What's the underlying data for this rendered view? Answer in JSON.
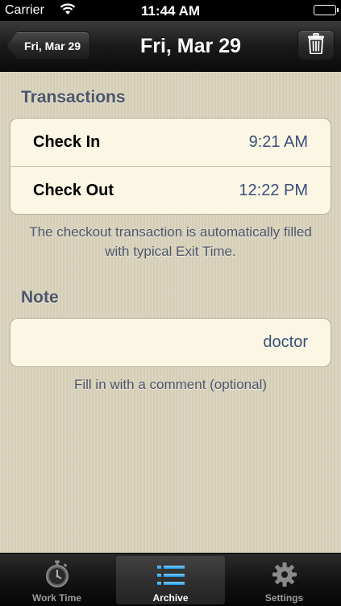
{
  "status_bar": {
    "carrier": "Carrier",
    "time": "11:44 AM"
  },
  "nav": {
    "back_label": "Fri, Mar 29",
    "title": "Fri, Mar 29"
  },
  "transactions": {
    "header": "Transactions",
    "rows": [
      {
        "label": "Check In",
        "value": "9:21 AM"
      },
      {
        "label": "Check Out",
        "value": "12:22 PM"
      }
    ],
    "footer": "The checkout transaction is automatically filled with typical Exit Time."
  },
  "note": {
    "header": "Note",
    "value": "doctor",
    "footer": "Fill in with a comment (optional)"
  },
  "tabs": [
    {
      "label": "Work Time",
      "icon": "stopwatch-icon"
    },
    {
      "label": "Archive",
      "icon": "list-icon",
      "active": true
    },
    {
      "label": "Settings",
      "icon": "gear-icon"
    }
  ],
  "colors": {
    "accent_value": "#3b4f7a",
    "section_header": "#4c566a",
    "background": "#d9d2bb",
    "cell": "#fbf7e4"
  }
}
